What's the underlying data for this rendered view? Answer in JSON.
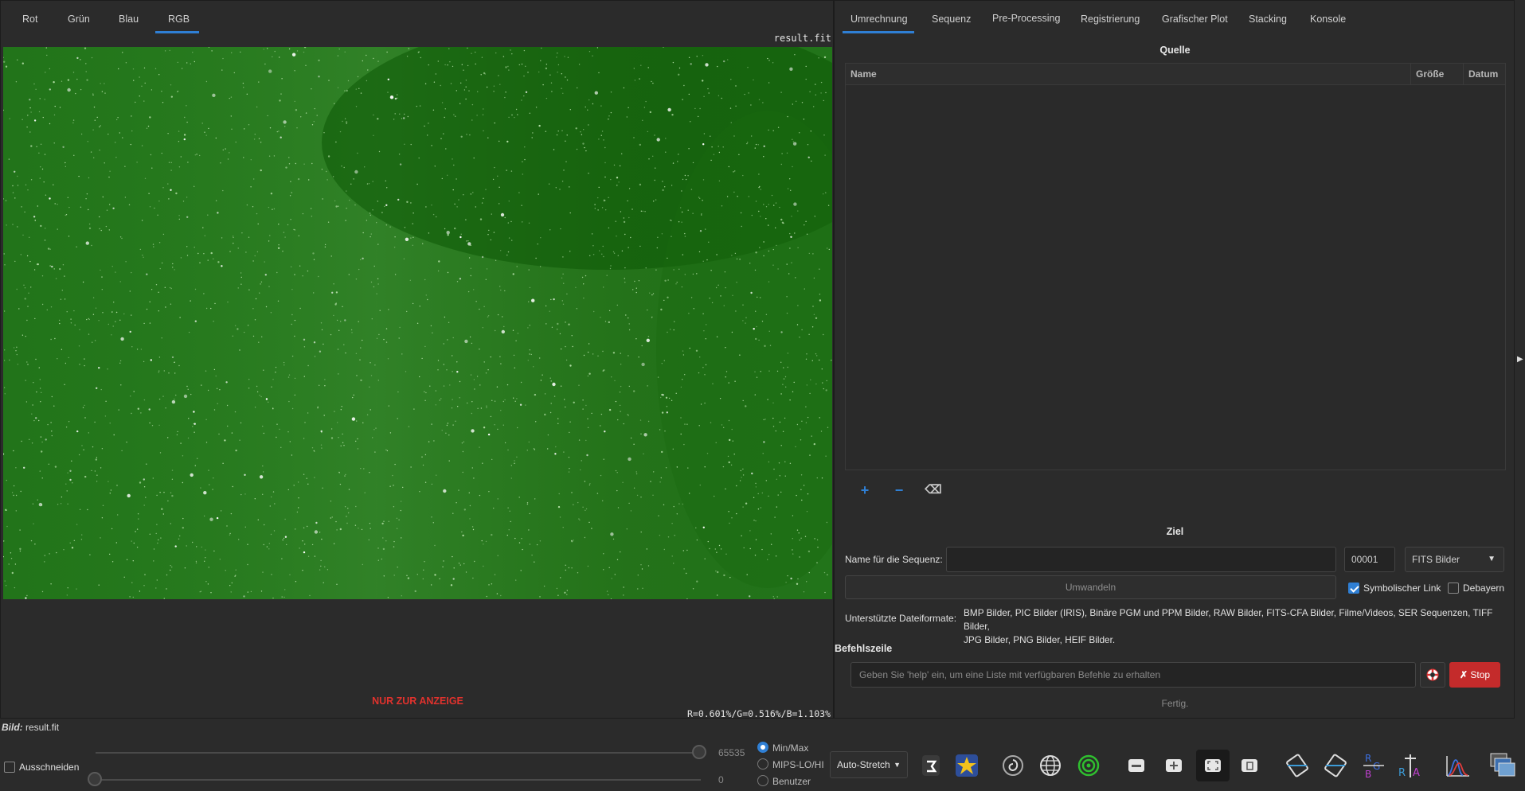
{
  "channel_tabs": [
    "Rot",
    "Grün",
    "Blau",
    "RGB"
  ],
  "image_filename": "result.fit",
  "display_only_label": "NUR ZUR ANZEIGE",
  "pixel_stats": "R=0.601%/G=0.516%/B=1.103%",
  "right_tabs": [
    "Umrechnung",
    "Sequenz",
    "Pre-Processing",
    "Registrierung",
    "Grafischer Plot",
    "Stacking",
    "Konsole"
  ],
  "source": {
    "title": "Quelle",
    "columns": [
      "Name",
      "Größe",
      "Datum"
    ],
    "add_label": "+",
    "remove_label": "−",
    "clear_label": "⌫"
  },
  "target": {
    "title": "Ziel",
    "seq_name_label": "Name für die Sequenz:",
    "seq_name_value": "",
    "index_value": "00001",
    "format_value": "FITS Bilder",
    "convert_label": "Umwandeln",
    "symlink_label": "Symbolischer Link",
    "symlink_checked": true,
    "debayer_label": "Debayern",
    "debayer_checked": false,
    "formats_label": "Unterstützte Dateiformate:",
    "formats_line1": "BMP Bilder, PIC Bilder (IRIS), Binäre PGM und PPM Bilder, RAW Bilder, FITS-CFA Bilder, Filme/Videos, SER Sequenzen, TIFF Bilder,",
    "formats_line2": "JPG Bilder, PNG Bilder, HEIF Bilder."
  },
  "command": {
    "title": "Befehlszeile",
    "placeholder": "Geben Sie 'help' ein, um eine Liste mit verfügbaren Befehle zu erhalten",
    "stop_label": "Stop",
    "status": "Fertig."
  },
  "bottom": {
    "image_label": "Bild:",
    "image_name": "result.fit",
    "crop_label": "Ausschneiden",
    "high_value": "65535",
    "low_value": "0",
    "radio_options": [
      "Min/Max",
      "MIPS-LO/HI",
      "Benutzer"
    ],
    "selected_radio": "Min/Max",
    "stretch_value": "Auto-Stretch"
  },
  "colors": {
    "accent": "#2f7fd4",
    "stop_button": "#c42b2b",
    "warning_text": "#e0322d",
    "image_green": "#1f6e12"
  },
  "toolbar_icons": [
    "undo-redo-icon",
    "star-icon",
    "galaxy-icon",
    "globe-icon",
    "target-icon",
    "minimize-icon",
    "plus-doc-icon",
    "fullscreen-icon",
    "rotate-icon",
    "mirror-x-icon",
    "mirror-y-icon",
    "rgb-align-icon",
    "rgb-compose-icon",
    "histogram-icon",
    "layers-icon"
  ]
}
